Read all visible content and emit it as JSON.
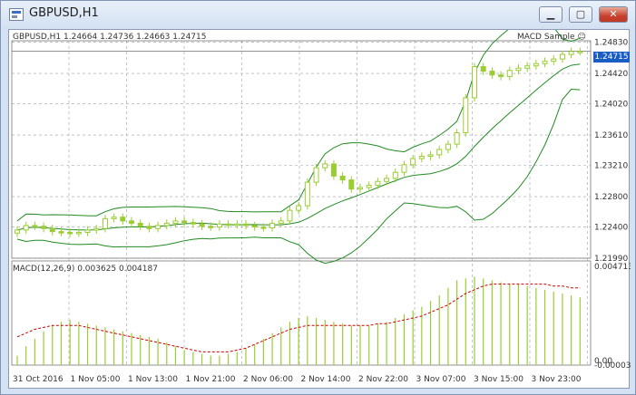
{
  "window": {
    "title": "GBPUSD,H1",
    "buttons": [
      "minimize",
      "maximize",
      "close"
    ]
  },
  "price_panel": {
    "header": "GBPUSD,H1  1.24664 1.24736 1.24663 1.24715",
    "indicator_name": "MACD Sample",
    "current_price": "1.24715",
    "y_ticks": [
      "1.24830",
      "1.24420",
      "1.24020",
      "1.23610",
      "1.23210",
      "1.22800",
      "1.22400",
      "1.21990"
    ]
  },
  "macd_panel": {
    "header": "MACD(12,26,9) 0.003625 0.004187",
    "y_ticks": [
      "0.004713",
      "0.00",
      "-0.000032"
    ]
  },
  "x_ticks": [
    "31 Oct 2016",
    "1 Nov 05:00",
    "1 Nov 13:00",
    "1 Nov 21:00",
    "2 Nov 06:00",
    "2 Nov 14:00",
    "2 Nov 22:00",
    "3 Nov 07:00",
    "3 Nov 15:00",
    "3 Nov 23:00"
  ],
  "colors": {
    "candle": "#9acd32",
    "bands": "#228b22",
    "signal": "#cc0000",
    "grid": "#9aa0a6",
    "price_tag": "#1a5dc5"
  },
  "chart_data": {
    "type": "candlestick",
    "ylim": [
      1.2199,
      1.2485
    ],
    "close": [
      1.2236,
      1.2242,
      1.2241,
      1.2238,
      1.2234,
      1.2233,
      1.2232,
      1.2233,
      1.2236,
      1.2238,
      1.2251,
      1.2253,
      1.2248,
      1.2245,
      1.2241,
      1.2238,
      1.2242,
      1.2245,
      1.2248,
      1.2246,
      1.2244,
      1.2241,
      1.224,
      1.2244,
      1.2243,
      1.2244,
      1.2242,
      1.224,
      1.2239,
      1.2245,
      1.2248,
      1.2262,
      1.2268,
      1.2299,
      1.2318,
      1.2323,
      1.2307,
      1.2302,
      1.229,
      1.2292,
      1.2295,
      1.23,
      1.2304,
      1.2312,
      1.2322,
      1.233,
      1.2333,
      1.2335,
      1.2342,
      1.2349,
      1.2364,
      1.241,
      1.2451,
      1.2445,
      1.244,
      1.2438,
      1.2446,
      1.2449,
      1.2452,
      1.2455,
      1.2458,
      1.2461,
      1.2467,
      1.2471,
      1.2471
    ],
    "macd_hist": [
      0.0005,
      0.001,
      0.0014,
      0.0018,
      0.0021,
      0.0023,
      0.0024,
      0.0023,
      0.0022,
      0.0021,
      0.002,
      0.0019,
      0.0018,
      0.0017,
      0.0016,
      0.0015,
      0.0014,
      0.0012,
      0.001,
      0.0008,
      0.0007,
      0.0006,
      0.0005,
      0.0005,
      0.0006,
      0.0007,
      0.0009,
      0.0011,
      0.0014,
      0.0017,
      0.002,
      0.0023,
      0.0025,
      0.0026,
      0.0025,
      0.0024,
      0.0023,
      0.0022,
      0.0021,
      0.0021,
      0.0021,
      0.0022,
      0.0023,
      0.0025,
      0.0027,
      0.0029,
      0.0031,
      0.0034,
      0.0037,
      0.0041,
      0.0045,
      0.0046,
      0.0047,
      0.0046,
      0.0045,
      0.0044,
      0.0043,
      0.0043,
      0.0042,
      0.0041,
      0.004,
      0.0039,
      0.0038,
      0.0037,
      0.0036
    ],
    "macd_signal": [
      0.0015,
      0.0017,
      0.0019,
      0.002,
      0.0021,
      0.0021,
      0.0021,
      0.0021,
      0.002,
      0.0019,
      0.0018,
      0.0017,
      0.0016,
      0.0015,
      0.0014,
      0.0013,
      0.0012,
      0.0011,
      0.001,
      0.0009,
      0.0008,
      0.0007,
      0.0007,
      0.0007,
      0.0007,
      0.0008,
      0.0009,
      0.0011,
      0.0013,
      0.0015,
      0.0017,
      0.0019,
      0.002,
      0.0021,
      0.0021,
      0.0021,
      0.0021,
      0.0021,
      0.0021,
      0.0021,
      0.0021,
      0.0022,
      0.0022,
      0.0023,
      0.0024,
      0.0025,
      0.0026,
      0.0028,
      0.003,
      0.0032,
      0.0035,
      0.0038,
      0.004,
      0.0042,
      0.0043,
      0.0043,
      0.0043,
      0.0043,
      0.0043,
      0.0043,
      0.0043,
      0.0042,
      0.0042,
      0.0041,
      0.0041
    ]
  }
}
